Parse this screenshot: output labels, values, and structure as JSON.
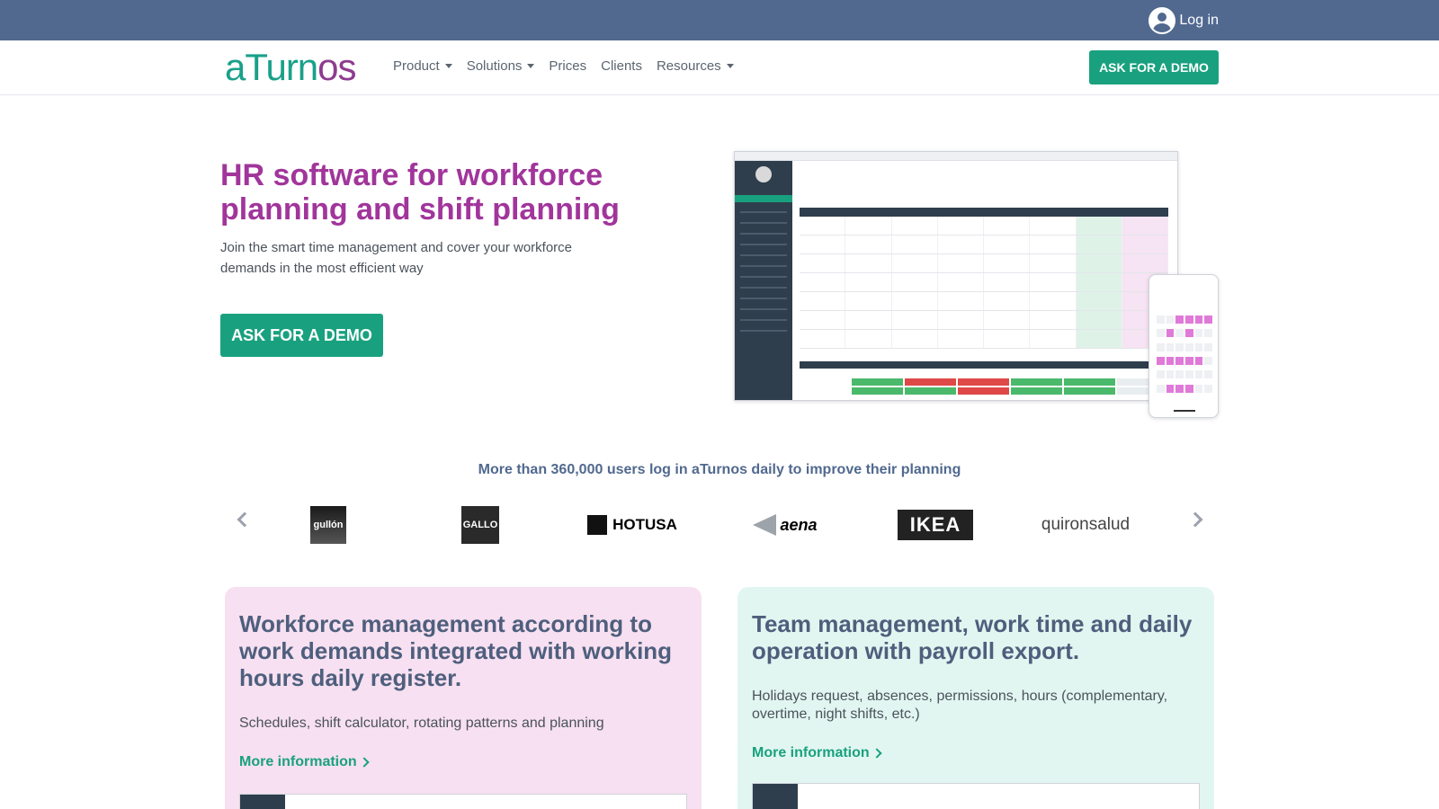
{
  "topbar": {
    "login_label": "Log in"
  },
  "nav": {
    "logo_prefix": "aTurn",
    "logo_accent": "os",
    "items": [
      {
        "label": "Product",
        "dropdown": true
      },
      {
        "label": "Solutions",
        "dropdown": true
      },
      {
        "label": "Prices",
        "dropdown": false
      },
      {
        "label": "Clients",
        "dropdown": false
      },
      {
        "label": "Resources",
        "dropdown": true
      }
    ],
    "cta_label": "ASK FOR A DEMO"
  },
  "hero": {
    "title": "HR software for workforce planning and shift planning",
    "subtitle": "Join the smart time management and cover your workforce demands in the most efficient way",
    "cta_label": "ASK FOR A DEMO"
  },
  "trust": {
    "text": "More than 360,000 users log in aTurnos daily to improve their planning"
  },
  "clients": [
    "gullón",
    "GALLO",
    "HOTUSA",
    "aena",
    "IKEA",
    "quironsalud"
  ],
  "cards": [
    {
      "title": "Workforce management according to work demands integrated with working hours daily register.",
      "text": "Schedules, shift calculator, rotating patterns and planning",
      "link": "More information"
    },
    {
      "title": "Team management, work time and daily operation with payroll export.",
      "text": "Holidays request, absences, permissions, hours (complementary, overtime, night shifts, etc.)",
      "link": "More information"
    }
  ],
  "colors": {
    "topbar": "#51698f",
    "brand_green": "#19a17f",
    "brand_purple": "#a1359b",
    "card_pink": "#f7e0f1",
    "card_mint": "#e2f6f1"
  }
}
